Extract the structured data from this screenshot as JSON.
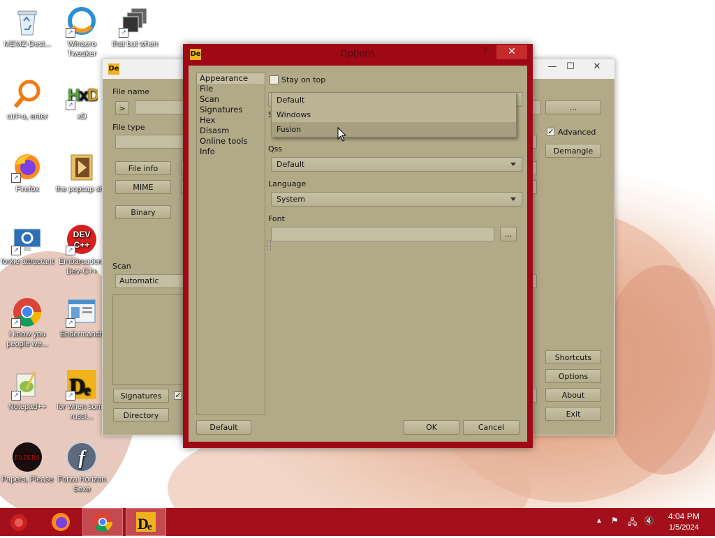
{
  "desktop": {
    "icons": [
      {
        "label": "MEMZ-Dest...",
        "icon": "recycle-bin-icon"
      },
      {
        "label": "Winaero Tweaker",
        "icon": "winaero-icon"
      },
      {
        "label": "that but when its a...",
        "icon": "stack-icon"
      },
      {
        "label": "ctrl+a, enter",
        "icon": "magnifier-icon"
      },
      {
        "label": "xD",
        "icon": "hxd-icon"
      },
      {
        "label": "Firefox",
        "icon": "firefox-icon"
      },
      {
        "label": "the popcap shit",
        "icon": "folder-icon"
      },
      {
        "label": "forkie attractant",
        "icon": "settings-monitor-icon"
      },
      {
        "label": "Embarcadero Dev-C++",
        "icon": "devcpp-icon"
      },
      {
        "label": "i know you people we...",
        "icon": "chrome-icon"
      },
      {
        "label": "Endermanch",
        "icon": "window-icon"
      },
      {
        "label": "Notepad++",
        "icon": "notepadpp-icon"
      },
      {
        "label": "for when some russi...",
        "icon": "die-icon"
      },
      {
        "label": "Papers, Please",
        "icon": "papers-please-icon"
      },
      {
        "label": "Forza Horizon Sexe",
        "icon": "flash-icon"
      }
    ]
  },
  "main_window": {
    "file_name_label": "File name",
    "browse_label": ">",
    "browse_more_label": "...",
    "file_type_label": "File type",
    "advanced_label": "Advanced",
    "advanced_checked": "✓",
    "demangle_label": "Demangle",
    "file_info_label": "File info",
    "mime_label": "MIME",
    "binary_label": "Binary",
    "scan_label": "Scan",
    "scan_value": "Automatic",
    "signatures_label": "Signatures",
    "directory_label": "Directory",
    "shortcuts_label": "Shortcuts",
    "options_label": "Options",
    "about_label": "About",
    "exit_label": "Exit",
    "minimize": "—",
    "maximize": "☐",
    "close": "✕"
  },
  "options_dialog": {
    "title": "Options",
    "help": "?",
    "close": "✕",
    "nav": [
      "Appearance",
      "File",
      "Scan",
      "Signatures",
      "Hex",
      "Disasm",
      "Online tools",
      "Info"
    ],
    "selected_nav": "Appearance",
    "stay_on_top_label": "Stay on top",
    "style_label": "S",
    "style_options": [
      "Default",
      "Windows",
      "Fusion"
    ],
    "style_highlighted": "Fusion",
    "qss_label": "Qss",
    "qss_value": "Default",
    "language_label": "Language",
    "language_value": "System",
    "font_label": "Font",
    "font_value": "",
    "font_browse": "...",
    "default_button": "Default",
    "ok_button": "OK",
    "cancel_button": "Cancel"
  },
  "taskbar": {
    "time": "4:04 PM",
    "date": "1/5/2024",
    "apps": [
      "memz-icon",
      "firefox-icon",
      "chrome-icon",
      "die-icon"
    ]
  },
  "colors": {
    "dialog_frame": "#a10816",
    "taskbar": "#a3101c",
    "panel": "#b2a987",
    "close": "#c52b2b"
  }
}
